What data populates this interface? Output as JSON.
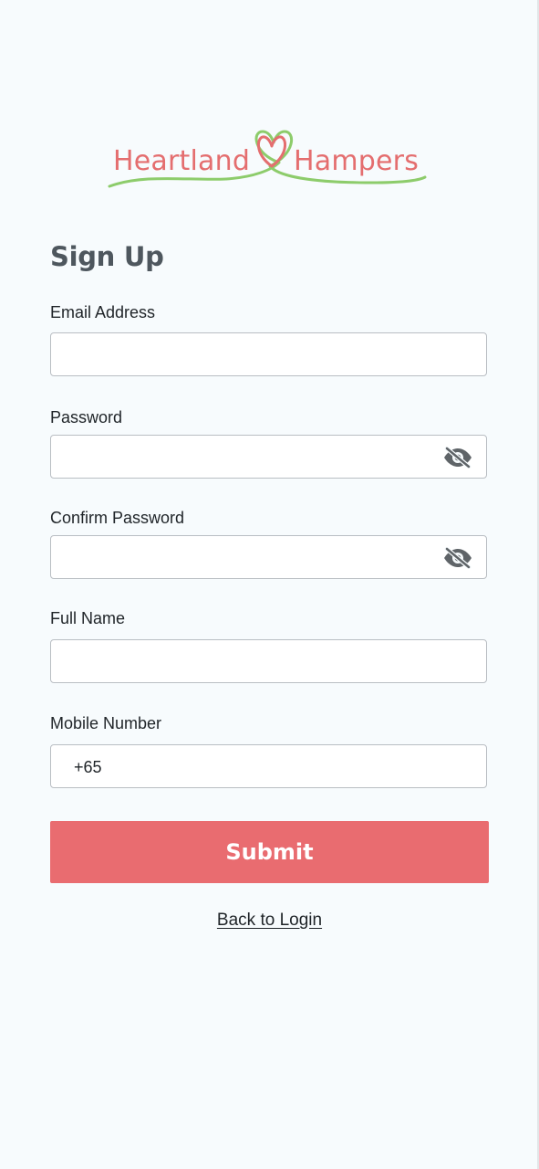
{
  "brand": {
    "name_left": "Heartland",
    "name_right": "Hampers",
    "primary_color": "#e96c70",
    "accent_color": "#8dcc6b"
  },
  "page": {
    "title": "Sign Up"
  },
  "form": {
    "email": {
      "label": "Email Address",
      "value": ""
    },
    "password": {
      "label": "Password",
      "value": "",
      "toggle_icon": "eye-slash-icon"
    },
    "confirm_password": {
      "label": "Confirm Password",
      "value": "",
      "toggle_icon": "eye-slash-icon"
    },
    "full_name": {
      "label": "Full Name",
      "value": ""
    },
    "mobile": {
      "label": "Mobile Number",
      "prefix": "+65",
      "value": ""
    }
  },
  "actions": {
    "submit_label": "Submit",
    "back_label": "Back to Login"
  }
}
